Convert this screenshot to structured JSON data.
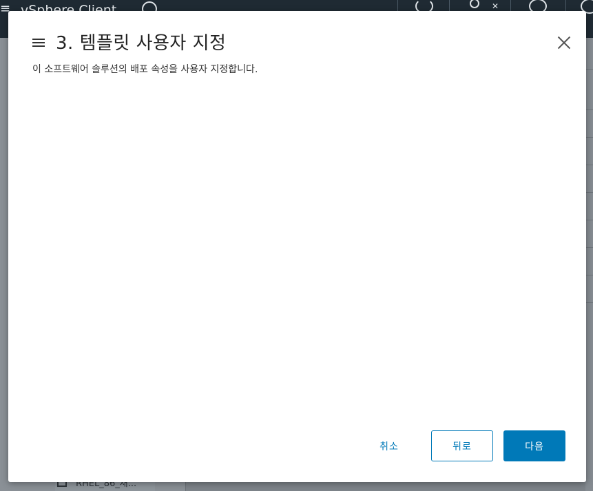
{
  "app": {
    "title": "vSphere Client",
    "tree_item_label": "RHEL_86_새..."
  },
  "modal": {
    "title": "3. 템플릿 사용자 지정",
    "subtitle": "이 소프트웨어 솔루션의 배포 속성을 사용자 지정합니다.",
    "buttons": {
      "cancel": "취소",
      "back": "뒤로",
      "next": "다음"
    }
  },
  "colors": {
    "accent": "#0079b8",
    "header_bg": "#1f2a33",
    "overlay_bg": "#7d8389"
  },
  "icons": [
    "hamburger-icon",
    "close-icon",
    "search-icon",
    "refresh-icon",
    "user-icon",
    "chevron-down-icon",
    "smiley-icon",
    "help-icon",
    "vm-icon"
  ]
}
